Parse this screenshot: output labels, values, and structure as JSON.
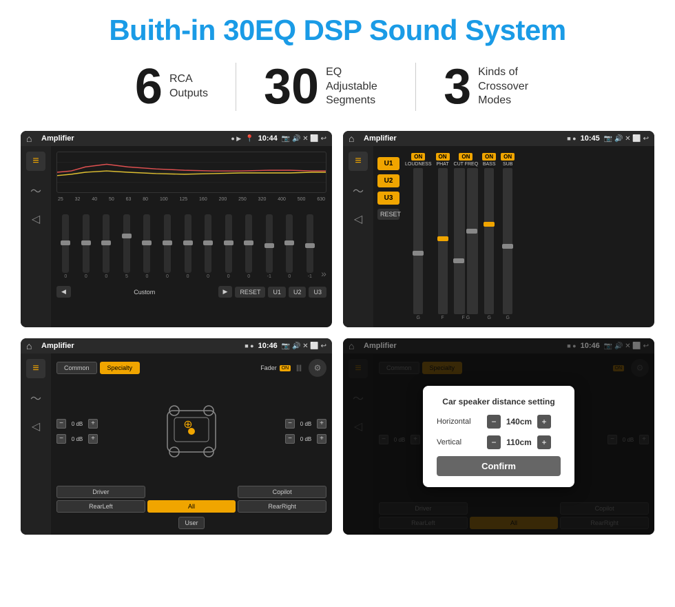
{
  "page": {
    "title": "Buith-in 30EQ DSP Sound System",
    "title_color": "#1a9be6"
  },
  "stats": [
    {
      "number": "6",
      "label": "RCA\nOutputs"
    },
    {
      "number": "30",
      "label": "EQ Adjustable\nSegments"
    },
    {
      "number": "3",
      "label": "Kinds of\nCrossover Modes"
    }
  ],
  "screen1": {
    "app_name": "Amplifier",
    "time": "10:44",
    "freq_labels": [
      "25",
      "32",
      "40",
      "50",
      "63",
      "80",
      "100",
      "125",
      "160",
      "200",
      "250",
      "320",
      "400",
      "500",
      "630"
    ],
    "slider_values": [
      "0",
      "0",
      "0",
      "5",
      "0",
      "0",
      "0",
      "0",
      "0",
      "0",
      "-1",
      "0",
      "-1"
    ],
    "bottom_btns": [
      "Custom",
      "RESET",
      "U1",
      "U2",
      "U3"
    ]
  },
  "screen2": {
    "app_name": "Amplifier",
    "time": "10:45",
    "presets": [
      "U1",
      "U2",
      "U3"
    ],
    "controls": [
      "LOUDNESS",
      "PHAT",
      "CUT FREQ",
      "BASS",
      "SUB"
    ],
    "reset_label": "RESET"
  },
  "screen3": {
    "app_name": "Amplifier",
    "time": "10:46",
    "tabs": [
      "Common",
      "Specialty"
    ],
    "fader_label": "Fader",
    "bottom_btns": [
      "Driver",
      "RearLeft",
      "All",
      "User",
      "RearRight",
      "Copilot"
    ],
    "db_values": [
      "0 dB",
      "0 dB",
      "0 dB",
      "0 dB"
    ]
  },
  "screen4": {
    "app_name": "Amplifier",
    "time": "10:46",
    "tabs": [
      "Common",
      "Specialty"
    ],
    "dialog": {
      "title": "Car speaker distance setting",
      "horizontal_label": "Horizontal",
      "horizontal_value": "140cm",
      "vertical_label": "Vertical",
      "vertical_value": "110cm",
      "confirm_label": "Confirm"
    },
    "db_values": [
      "0 dB",
      "0 dB"
    ],
    "bottom_btns": [
      "Driver",
      "RearLeft",
      "All",
      "User",
      "RearRight",
      "Copilot"
    ]
  }
}
